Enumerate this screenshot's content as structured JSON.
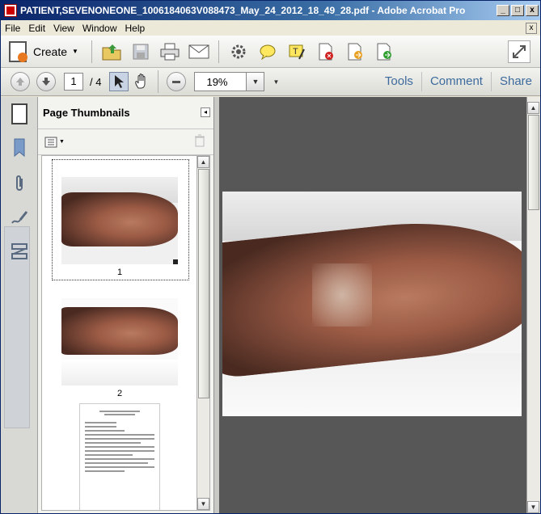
{
  "window": {
    "title": "PATIENT,SEVENONEONE_1006184063V088473_May_24_2012_18_49_28.pdf - Adobe Acrobat Pro",
    "min_label": "_",
    "max_label": "□",
    "close_label": "x"
  },
  "menu": [
    "File",
    "Edit",
    "View",
    "Window",
    "Help"
  ],
  "menu_close": "x",
  "toolbar": {
    "create_label": "Create",
    "create_arrow": "▼"
  },
  "nav": {
    "page_current": "1",
    "page_sep": "/ 4",
    "zoom_value": "19%",
    "zoom_arrow": "▼",
    "more_arrow": "▼"
  },
  "links": {
    "tools": "Tools",
    "comment": "Comment",
    "share": "Share"
  },
  "panel": {
    "title": "Page Thumbnails",
    "collapse": "◂"
  },
  "thumbnails": [
    {
      "label": "1"
    },
    {
      "label": "2"
    }
  ],
  "colors": {
    "titlebar": "#0a246a",
    "link": "#3c6b9c",
    "doc_background": "#575757"
  }
}
